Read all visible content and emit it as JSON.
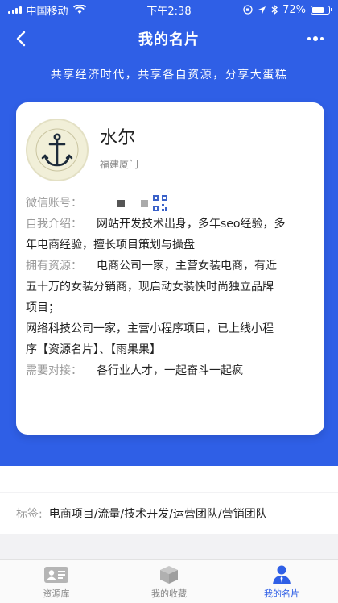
{
  "status_bar": {
    "carrier": "中国移动",
    "time": "下午2:38",
    "battery": "72%",
    "battery_level": 0.72
  },
  "nav": {
    "title": "我的名片"
  },
  "tagline": "共享经济时代，共享各自资源，分享大蛋糕",
  "card": {
    "name": "水尔",
    "location": "福建厦门",
    "wechat_label": "微信账号：",
    "intro_label": "自我介绍：",
    "intro_text_1": "网站开发技术出身，多年seo经验，多",
    "intro_text_2": "年电商经验，擅长项目策划与操盘",
    "resources_label": "拥有资源：",
    "resources_text_1": "电商公司一家，主营女装电商，有近",
    "resources_text_2": "五十万的女装分销商，现启动女装快时尚独立品牌",
    "resources_text_3": "项目；",
    "resources_text_4": "网络科技公司一家，主营小程序项目，已上线小程",
    "resources_text_5": "序【资源名片】、【雨果果】",
    "needs_label": "需要对接：",
    "needs_text": "各行业人才，一起奋斗一起疯"
  },
  "tags": {
    "label": "标签:",
    "value": "电商项目/流量/技术开发/运营团队/营销团队"
  },
  "tab_bar": {
    "tabs": [
      {
        "label": "资源库",
        "icon": "id-card-icon"
      },
      {
        "label": "我的收藏",
        "icon": "box-icon"
      },
      {
        "label": "我的名片",
        "icon": "person-icon"
      }
    ]
  },
  "colors": {
    "accent": "#2f5fe6"
  }
}
